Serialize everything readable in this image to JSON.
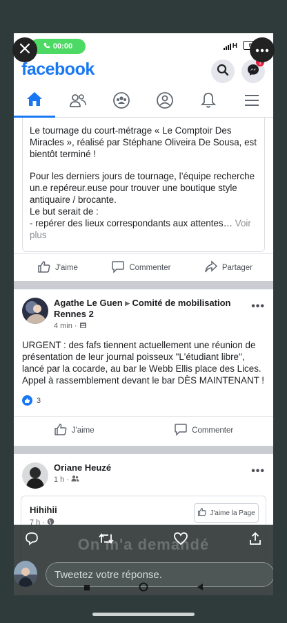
{
  "status_bar": {
    "call_time": "00:00",
    "network": "H",
    "battery": "64"
  },
  "header": {
    "logo": "facebook",
    "messenger_badge": "1"
  },
  "nav": [
    "home-icon",
    "friends-icon",
    "groups-icon",
    "profile-icon",
    "notifications-icon",
    "menu-icon"
  ],
  "post1": {
    "paragraph1": "Le tournage du court-métrage « Le Comptoir Des Miracles », réalisé par Stéphane Oliveira De Sousa, est bientôt terminé !",
    "paragraph2": "Pour les derniers jours de tournage, l’équipe recherche un.e repéreur.euse pour trouver une boutique style antiquaire / brocante.",
    "line3": "Le but serait de :",
    "line4": "- repérer des lieux correspondants aux attentes…",
    "see_more": "Voir plus",
    "like": "J'aime",
    "comment": "Commenter",
    "share": "Partager"
  },
  "post2": {
    "author": "Agathe Le Guen",
    "arrow": "▸",
    "group": "Comité de mobilisation Rennes 2",
    "time": "4 min",
    "body_line1": "URGENT : des fafs tiennent actuellement une réunion  de présentation de leur journal poisseux \"L'étudiant libre\", lancé par la cocarde, au bar le Webb Ellis place des Lices.",
    "body_line2": "Appel à rassemblement devant le bar DÈS MAINTENANT !",
    "reaction_count": "3",
    "like": "J'aime",
    "comment": "Commenter"
  },
  "post3": {
    "author": "Oriane Heuzé",
    "time": "1 h",
    "page_title": "Hihihii",
    "page_time": "7 h",
    "like_page": "J'aime la Page"
  },
  "twitter": {
    "overlay_text": "On m'a demandé",
    "reply_placeholder": "Tweetez votre réponse."
  },
  "colors": {
    "facebook_blue": "#1877f2",
    "call_green": "#4cd964",
    "badge_red": "#e41e3f"
  }
}
